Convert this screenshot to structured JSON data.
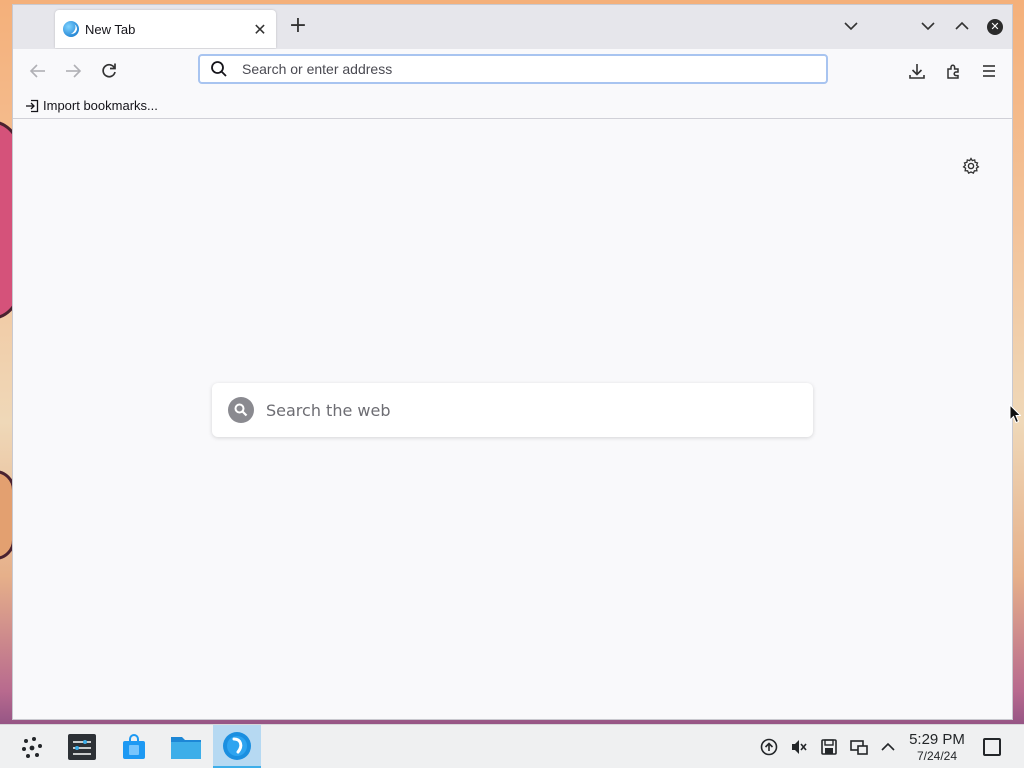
{
  "browser": {
    "tab": {
      "title": "New Tab",
      "close_glyph": "✕",
      "favicon": "browser-logo-icon"
    },
    "newtab_glyph": "+",
    "urlbar": {
      "placeholder": "Search or enter address",
      "value": ""
    },
    "bookmarks": [
      {
        "label": "Import bookmarks...",
        "icon": "import-icon"
      }
    ],
    "content": {
      "websearch": {
        "placeholder": "Search the web",
        "value": ""
      }
    }
  },
  "taskbar": {
    "apps": [
      {
        "name": "Settings",
        "icon": "settings-app-icon"
      },
      {
        "name": "Discover",
        "icon": "store-app-icon"
      },
      {
        "name": "Files",
        "icon": "folder-app-icon"
      },
      {
        "name": "Browser",
        "icon": "browser-app-icon",
        "active": true
      }
    ],
    "clock": {
      "time": "5:29 PM",
      "date": "7/24/24"
    }
  },
  "colors": {
    "accent": "#3daee9",
    "urlbar_focus": "#a8c4f0",
    "content_bg": "#f9f9fb"
  }
}
